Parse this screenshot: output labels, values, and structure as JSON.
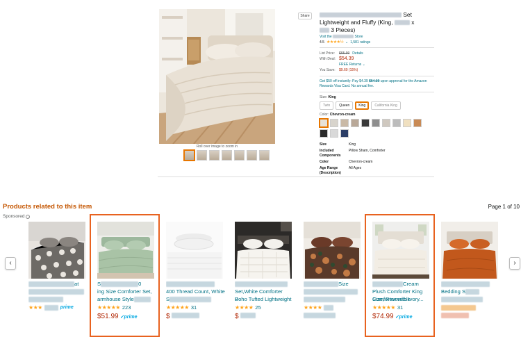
{
  "product": {
    "title_line1_tail": "Set",
    "title_line2": "Lightweight and Fluffy (King,",
    "title_line2_tail": "x",
    "title_line3": "3 Pieces)",
    "store_prefix": "Visit the",
    "store_suffix": "Store",
    "rating_value": "4.5",
    "ratings_count": "1,581 ratings",
    "share_label": "Share",
    "zoom_hint": "Roll over image to zoom in",
    "list_price_label": "List Price:",
    "list_price": "$65.99",
    "details_link": "Details",
    "with_deal_label": "With Deal:",
    "deal_price": "$54.39",
    "free_returns": "FREE Returns",
    "you_save_label": "You Save:",
    "you_save": "$9.60 (15%)",
    "offer_text_a": "Get $50 off instantly: Pay $4.39",
    "offer_strike": "$54.39",
    "offer_text_b": "upon approval for the Amazon Rewards Visa Card. No annual fee.",
    "size_label": "Size:",
    "size_selected": "King",
    "sizes": [
      "Twin",
      "Queen",
      "King",
      "California King"
    ],
    "color_label": "Color:",
    "color_selected": "Chevron-cream",
    "swatch_colors": [
      "#e8e2d8",
      "#d8d4cc",
      "#c9b9a6",
      "#b9a898",
      "#3a3a3a",
      "#8e8e8e",
      "#cfc8bf",
      "#bcbcbc",
      "#f0e0c0",
      "#c98a55",
      "#2b2b2b",
      "#d9d9d9",
      "#2c3e66"
    ],
    "specs": [
      {
        "k": "Size",
        "v": "King"
      },
      {
        "k": "Included Components",
        "v": "Pillow Sham, Comforter"
      },
      {
        "k": "Color",
        "v": "Chevron-cream"
      },
      {
        "k": "Age Range (Description)",
        "v": "All Ages"
      }
    ]
  },
  "related": {
    "title": "Products related to this item",
    "page_indicator": "Page 1 of 10",
    "sponsored": "Sponsored",
    "arrow_left": "‹",
    "arrow_right": "›",
    "cards": [
      {
        "t1": "",
        "t1b": "at",
        "t2": "",
        "t3": "",
        "stars": "★★★",
        "count": "",
        "price": "",
        "prime": "prime"
      },
      {
        "t1": "S",
        "t1b": "0",
        "t2": "ing Size Comforter Set,",
        "t3": "armhouse Style",
        "stars": "★★★★★",
        "count": "223",
        "price": "$51.99",
        "prime": "prime"
      },
      {
        "t1": "",
        "t1b": "",
        "t2": "400 Thread Count, White",
        "t3": "S",
        "stars": "★★★★★",
        "count": "31",
        "price": "$",
        "prime": ""
      },
      {
        "t1": "",
        "t1b": "",
        "t2": "Set,White Comforter",
        "t3": "Boho Tufted Lightweight",
        "t4": "P",
        "stars": "★★★★",
        "count": "25",
        "price": "$",
        "prime": ""
      },
      {
        "t1": "",
        "t1b": "Size",
        "t2": "",
        "t3": "",
        "stars": "★★★★",
        "count": "",
        "price": "",
        "prime": ""
      },
      {
        "t1": "",
        "t1b": "Cream",
        "t2": "Plush Comforter King",
        "t3": "Size, Reversible",
        "t4": "Comforter with Ivory...",
        "stars": "★★★★★",
        "count": "31",
        "price": "$74.99",
        "prime": "prime"
      },
      {
        "t1": "",
        "t1b": "",
        "t2": "Bedding S",
        "t3": "",
        "stars": "",
        "count": "",
        "price": "",
        "prime": ""
      }
    ]
  }
}
